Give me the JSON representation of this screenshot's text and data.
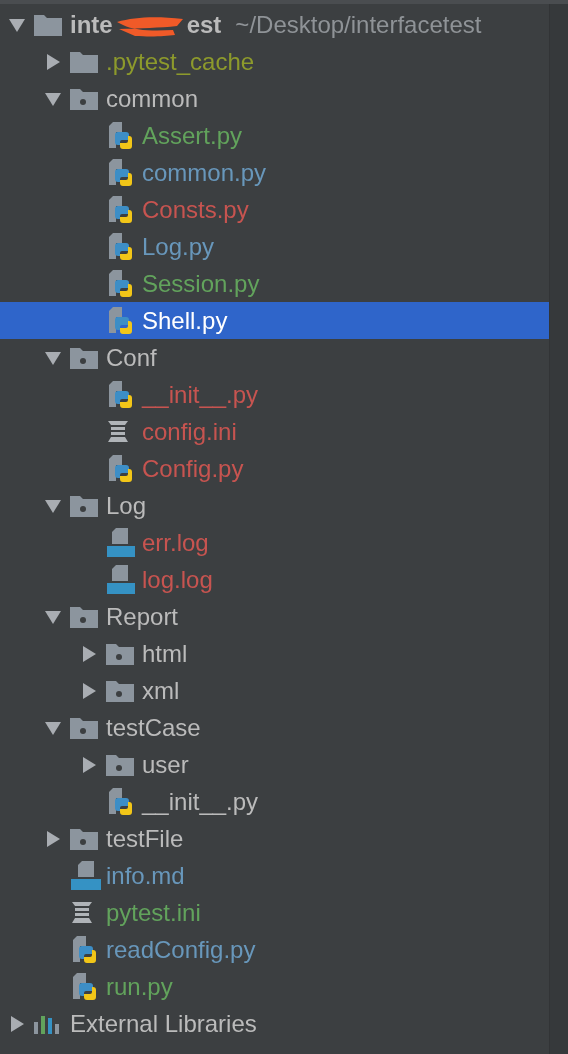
{
  "tree": [
    {
      "kind": "folder",
      "name_start": "inte",
      "name_end": "est",
      "path": "~/Desktop/interfacetest",
      "expanded": true,
      "selected": false,
      "color": "#bbbbbb",
      "children": [
        {
          "kind": "folder",
          "name": ".pytest_cache",
          "expanded": false,
          "selected": false,
          "color": "#8d9a2c"
        },
        {
          "kind": "module",
          "name": "common",
          "expanded": true,
          "selected": false,
          "color": "#bbbbbb",
          "children": [
            {
              "kind": "py",
              "name": "Assert.py",
              "selected": false,
              "color": "#62a35c"
            },
            {
              "kind": "py",
              "name": "common.py",
              "selected": false,
              "color": "#6897bb"
            },
            {
              "kind": "py",
              "name": "Consts.py",
              "selected": false,
              "color": "#c75450"
            },
            {
              "kind": "py",
              "name": "Log.py",
              "selected": false,
              "color": "#6897bb"
            },
            {
              "kind": "py",
              "name": "Session.py",
              "selected": false,
              "color": "#62a35c"
            },
            {
              "kind": "py",
              "name": "Shell.py",
              "selected": true,
              "color": "#ffffff"
            }
          ]
        },
        {
          "kind": "module",
          "name": "Conf",
          "expanded": true,
          "selected": false,
          "color": "#bbbbbb",
          "children": [
            {
              "kind": "py",
              "name": "__init__.py",
              "selected": false,
              "color": "#c75450"
            },
            {
              "kind": "ini",
              "name": "config.ini",
              "selected": false,
              "color": "#c75450"
            },
            {
              "kind": "py",
              "name": "Config.py",
              "selected": false,
              "color": "#c75450"
            }
          ]
        },
        {
          "kind": "module",
          "name": "Log",
          "expanded": true,
          "selected": false,
          "color": "#bbbbbb",
          "children": [
            {
              "kind": "log",
              "name": "err.log",
              "selected": false,
              "color": "#c75450"
            },
            {
              "kind": "log",
              "name": "log.log",
              "selected": false,
              "color": "#c75450"
            }
          ]
        },
        {
          "kind": "module",
          "name": "Report",
          "expanded": true,
          "selected": false,
          "color": "#bbbbbb",
          "children": [
            {
              "kind": "module",
              "name": "html",
              "expanded": false,
              "selected": false,
              "color": "#bbbbbb"
            },
            {
              "kind": "module",
              "name": "xml",
              "expanded": false,
              "selected": false,
              "color": "#bbbbbb"
            }
          ]
        },
        {
          "kind": "module",
          "name": "testCase",
          "expanded": true,
          "selected": false,
          "color": "#bbbbbb",
          "children": [
            {
              "kind": "module",
              "name": "user",
              "expanded": false,
              "selected": false,
              "color": "#bbbbbb"
            },
            {
              "kind": "py",
              "name": "__init__.py",
              "selected": false,
              "color": "#bbbbbb"
            }
          ]
        },
        {
          "kind": "module",
          "name": "testFile",
          "expanded": false,
          "selected": false,
          "color": "#bbbbbb"
        },
        {
          "kind": "md",
          "name": "info.md",
          "selected": false,
          "color": "#6897bb"
        },
        {
          "kind": "ini",
          "name": "pytest.ini",
          "selected": false,
          "color": "#62a35c"
        },
        {
          "kind": "py",
          "name": "readConfig.py",
          "selected": false,
          "color": "#6897bb"
        },
        {
          "kind": "py",
          "name": "run.py",
          "selected": false,
          "color": "#62a35c"
        }
      ]
    },
    {
      "kind": "library",
      "name": "External Libraries",
      "expanded": false,
      "selected": false,
      "color": "#bbbbbb"
    }
  ]
}
